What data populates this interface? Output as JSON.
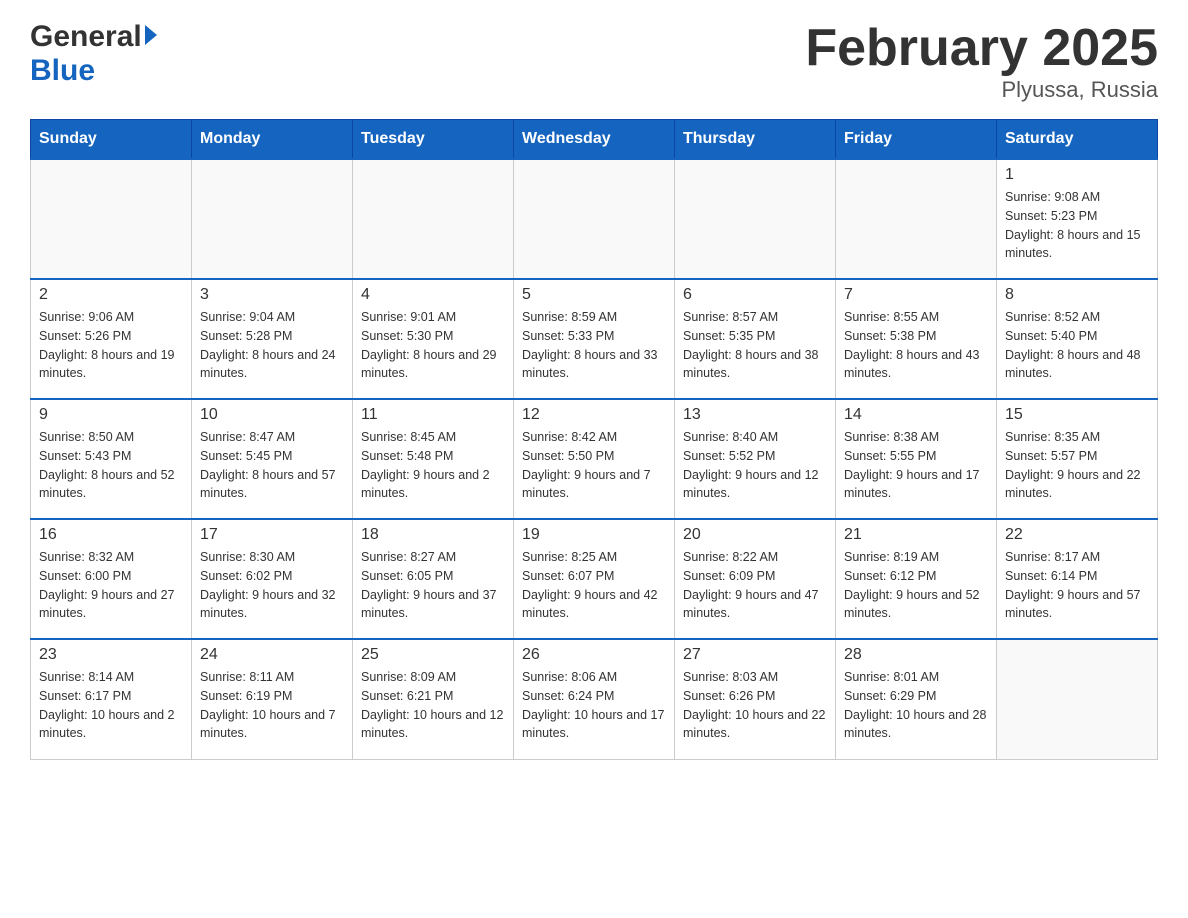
{
  "header": {
    "logo_general": "General",
    "logo_blue": "Blue",
    "title": "February 2025",
    "subtitle": "Plyussa, Russia"
  },
  "days_of_week": [
    "Sunday",
    "Monday",
    "Tuesday",
    "Wednesday",
    "Thursday",
    "Friday",
    "Saturday"
  ],
  "weeks": [
    [
      {
        "day": "",
        "sunrise": "",
        "sunset": "",
        "daylight": ""
      },
      {
        "day": "",
        "sunrise": "",
        "sunset": "",
        "daylight": ""
      },
      {
        "day": "",
        "sunrise": "",
        "sunset": "",
        "daylight": ""
      },
      {
        "day": "",
        "sunrise": "",
        "sunset": "",
        "daylight": ""
      },
      {
        "day": "",
        "sunrise": "",
        "sunset": "",
        "daylight": ""
      },
      {
        "day": "",
        "sunrise": "",
        "sunset": "",
        "daylight": ""
      },
      {
        "day": "1",
        "sunrise": "Sunrise: 9:08 AM",
        "sunset": "Sunset: 5:23 PM",
        "daylight": "Daylight: 8 hours and 15 minutes."
      }
    ],
    [
      {
        "day": "2",
        "sunrise": "Sunrise: 9:06 AM",
        "sunset": "Sunset: 5:26 PM",
        "daylight": "Daylight: 8 hours and 19 minutes."
      },
      {
        "day": "3",
        "sunrise": "Sunrise: 9:04 AM",
        "sunset": "Sunset: 5:28 PM",
        "daylight": "Daylight: 8 hours and 24 minutes."
      },
      {
        "day": "4",
        "sunrise": "Sunrise: 9:01 AM",
        "sunset": "Sunset: 5:30 PM",
        "daylight": "Daylight: 8 hours and 29 minutes."
      },
      {
        "day": "5",
        "sunrise": "Sunrise: 8:59 AM",
        "sunset": "Sunset: 5:33 PM",
        "daylight": "Daylight: 8 hours and 33 minutes."
      },
      {
        "day": "6",
        "sunrise": "Sunrise: 8:57 AM",
        "sunset": "Sunset: 5:35 PM",
        "daylight": "Daylight: 8 hours and 38 minutes."
      },
      {
        "day": "7",
        "sunrise": "Sunrise: 8:55 AM",
        "sunset": "Sunset: 5:38 PM",
        "daylight": "Daylight: 8 hours and 43 minutes."
      },
      {
        "day": "8",
        "sunrise": "Sunrise: 8:52 AM",
        "sunset": "Sunset: 5:40 PM",
        "daylight": "Daylight: 8 hours and 48 minutes."
      }
    ],
    [
      {
        "day": "9",
        "sunrise": "Sunrise: 8:50 AM",
        "sunset": "Sunset: 5:43 PM",
        "daylight": "Daylight: 8 hours and 52 minutes."
      },
      {
        "day": "10",
        "sunrise": "Sunrise: 8:47 AM",
        "sunset": "Sunset: 5:45 PM",
        "daylight": "Daylight: 8 hours and 57 minutes."
      },
      {
        "day": "11",
        "sunrise": "Sunrise: 8:45 AM",
        "sunset": "Sunset: 5:48 PM",
        "daylight": "Daylight: 9 hours and 2 minutes."
      },
      {
        "day": "12",
        "sunrise": "Sunrise: 8:42 AM",
        "sunset": "Sunset: 5:50 PM",
        "daylight": "Daylight: 9 hours and 7 minutes."
      },
      {
        "day": "13",
        "sunrise": "Sunrise: 8:40 AM",
        "sunset": "Sunset: 5:52 PM",
        "daylight": "Daylight: 9 hours and 12 minutes."
      },
      {
        "day": "14",
        "sunrise": "Sunrise: 8:38 AM",
        "sunset": "Sunset: 5:55 PM",
        "daylight": "Daylight: 9 hours and 17 minutes."
      },
      {
        "day": "15",
        "sunrise": "Sunrise: 8:35 AM",
        "sunset": "Sunset: 5:57 PM",
        "daylight": "Daylight: 9 hours and 22 minutes."
      }
    ],
    [
      {
        "day": "16",
        "sunrise": "Sunrise: 8:32 AM",
        "sunset": "Sunset: 6:00 PM",
        "daylight": "Daylight: 9 hours and 27 minutes."
      },
      {
        "day": "17",
        "sunrise": "Sunrise: 8:30 AM",
        "sunset": "Sunset: 6:02 PM",
        "daylight": "Daylight: 9 hours and 32 minutes."
      },
      {
        "day": "18",
        "sunrise": "Sunrise: 8:27 AM",
        "sunset": "Sunset: 6:05 PM",
        "daylight": "Daylight: 9 hours and 37 minutes."
      },
      {
        "day": "19",
        "sunrise": "Sunrise: 8:25 AM",
        "sunset": "Sunset: 6:07 PM",
        "daylight": "Daylight: 9 hours and 42 minutes."
      },
      {
        "day": "20",
        "sunrise": "Sunrise: 8:22 AM",
        "sunset": "Sunset: 6:09 PM",
        "daylight": "Daylight: 9 hours and 47 minutes."
      },
      {
        "day": "21",
        "sunrise": "Sunrise: 8:19 AM",
        "sunset": "Sunset: 6:12 PM",
        "daylight": "Daylight: 9 hours and 52 minutes."
      },
      {
        "day": "22",
        "sunrise": "Sunrise: 8:17 AM",
        "sunset": "Sunset: 6:14 PM",
        "daylight": "Daylight: 9 hours and 57 minutes."
      }
    ],
    [
      {
        "day": "23",
        "sunrise": "Sunrise: 8:14 AM",
        "sunset": "Sunset: 6:17 PM",
        "daylight": "Daylight: 10 hours and 2 minutes."
      },
      {
        "day": "24",
        "sunrise": "Sunrise: 8:11 AM",
        "sunset": "Sunset: 6:19 PM",
        "daylight": "Daylight: 10 hours and 7 minutes."
      },
      {
        "day": "25",
        "sunrise": "Sunrise: 8:09 AM",
        "sunset": "Sunset: 6:21 PM",
        "daylight": "Daylight: 10 hours and 12 minutes."
      },
      {
        "day": "26",
        "sunrise": "Sunrise: 8:06 AM",
        "sunset": "Sunset: 6:24 PM",
        "daylight": "Daylight: 10 hours and 17 minutes."
      },
      {
        "day": "27",
        "sunrise": "Sunrise: 8:03 AM",
        "sunset": "Sunset: 6:26 PM",
        "daylight": "Daylight: 10 hours and 22 minutes."
      },
      {
        "day": "28",
        "sunrise": "Sunrise: 8:01 AM",
        "sunset": "Sunset: 6:29 PM",
        "daylight": "Daylight: 10 hours and 28 minutes."
      },
      {
        "day": "",
        "sunrise": "",
        "sunset": "",
        "daylight": ""
      }
    ]
  ]
}
